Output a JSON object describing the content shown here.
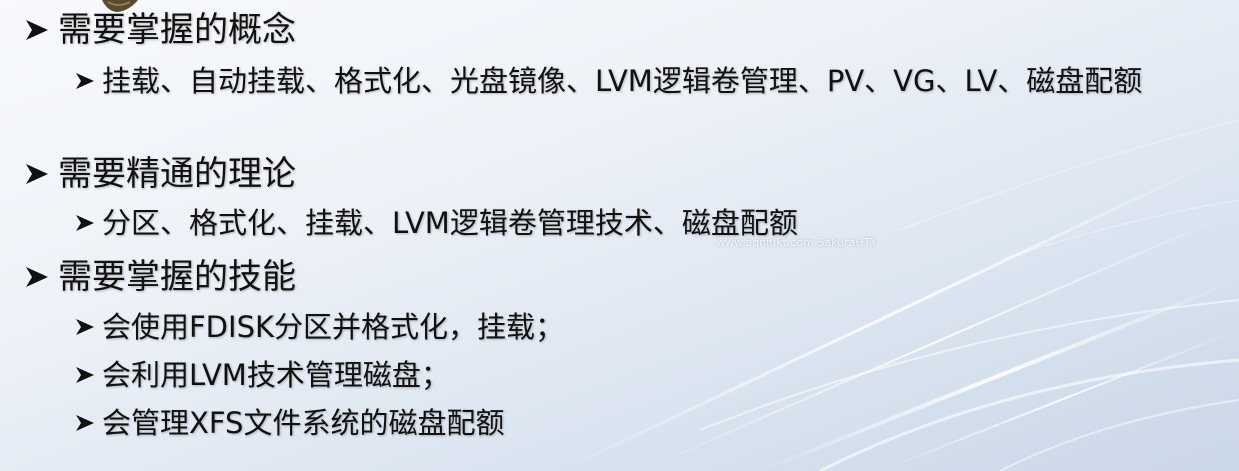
{
  "colors": {
    "text": "#111111",
    "bullet": "#111111",
    "background_light": "#f7f9fc",
    "background_dark": "#cad7e8"
  },
  "bullet_icon": "arrow-bullet-icon",
  "sections": [
    {
      "heading": "需要掌握的概念",
      "items": [
        "挂载、自动挂载、格式化、光盘镜像、LVM逻辑卷管理、PV、VG、LV、磁盘配额"
      ]
    },
    {
      "heading": "需要精通的理论",
      "items": [
        "分区、格式化、挂载、LVM逻辑卷管理技术、磁盘配额"
      ]
    },
    {
      "heading": "需要掌握的技能",
      "items": [
        "会使用FDISK分区并格式化，挂载；",
        "会利用LVM技术管理磁盘；",
        "会管理XFS文件系统的磁盘配额"
      ]
    }
  ],
  "watermark": "www.aqniukt.com  SakuraHTY"
}
